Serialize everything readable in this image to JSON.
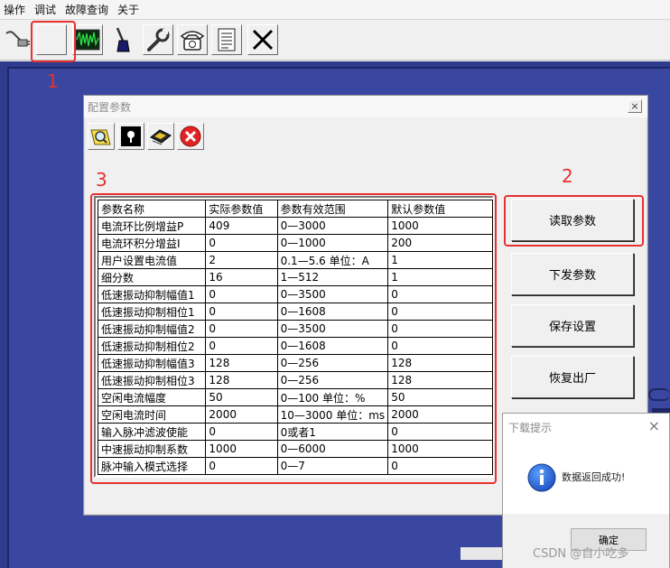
{
  "menu": {
    "items": [
      "操作",
      "调试",
      "故障查询",
      "关于"
    ]
  },
  "toolbar": {
    "icons": [
      "plug-icon",
      "blank-button",
      "oscilloscope-icon",
      "brush-icon",
      "wrench-icon",
      "telephone-icon",
      "document-icon",
      "close-x-icon"
    ]
  },
  "annotations": {
    "one": "1",
    "two": "2",
    "three": "3"
  },
  "config_dialog": {
    "title": "配置参数",
    "close": "×",
    "table": {
      "headers": [
        "参数名称",
        "实际参数值",
        "参数有效范围",
        "默认参数值"
      ],
      "rows": [
        [
          "电流环比例增益P",
          "409",
          "0—3000",
          "1000"
        ],
        [
          "电流环积分增益I",
          "0",
          "0—1000",
          "200"
        ],
        [
          "用户设置电流值",
          "2",
          "0.1—5.6 单位：A",
          "1"
        ],
        [
          "细分数",
          "16",
          "1—512",
          "1"
        ],
        [
          "低速振动抑制幅值1",
          "0",
          "0—3500",
          "0"
        ],
        [
          "低速振动抑制相位1",
          "0",
          "0—1608",
          "0"
        ],
        [
          "低速振动抑制幅值2",
          "0",
          "0—3500",
          "0"
        ],
        [
          "低速振动抑制相位2",
          "0",
          "0—1608",
          "0"
        ],
        [
          "低速振动抑制幅值3",
          "128",
          "0—256",
          "128"
        ],
        [
          "低速振动抑制相位3",
          "128",
          "0—256",
          "128"
        ],
        [
          "空闲电流幅度",
          "50",
          "0—100 单位：%",
          "50"
        ],
        [
          "空闲电流时间",
          "2000",
          "10—3000 单位：ms",
          "2000"
        ],
        [
          "输入脉冲滤波使能",
          "0",
          "0或者1",
          "0"
        ],
        [
          "中速振动抑制系数",
          "1000",
          "0—6000",
          "1000"
        ],
        [
          "脉冲输入模式选择",
          "0",
          "0—7",
          "0"
        ]
      ]
    }
  },
  "side_buttons": {
    "read": "读取参数",
    "send": "下发参数",
    "save": "保存设置",
    "restore": "恢复出厂"
  },
  "message_box": {
    "title": "下载提示",
    "close": "×",
    "text": "数据返回成功!",
    "ok": "确定"
  },
  "watermark": "CSDN @自小吃多",
  "colors": {
    "annotation_red": "#e53131",
    "workspace_blue": "#3a47a1"
  }
}
